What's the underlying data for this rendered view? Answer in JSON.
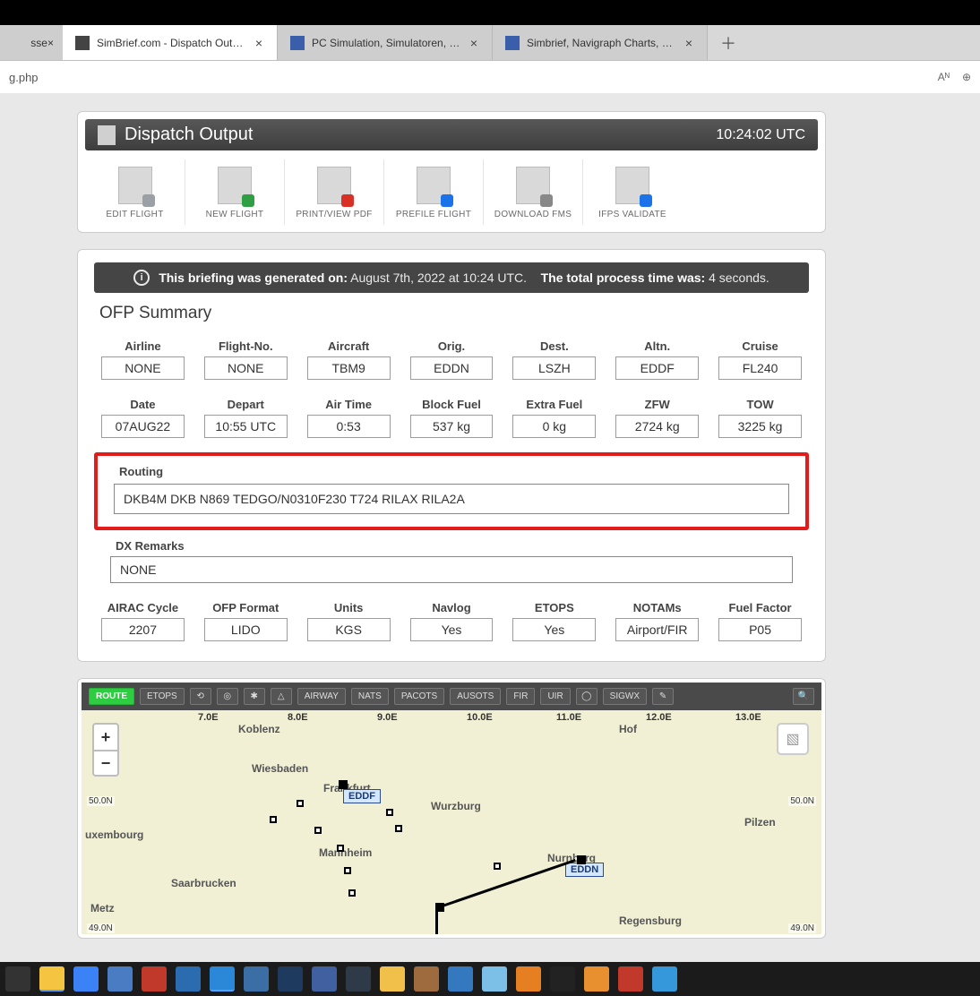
{
  "browser": {
    "tab_fragment": "sse",
    "tabs": [
      {
        "label": "SimBrief.com - Dispatch Output",
        "active": true,
        "favtype": "sb"
      },
      {
        "label": "PC Simulation, Simulatoren, Harc",
        "active": false,
        "favtype": "blue"
      },
      {
        "label": "Simbrief, Navigraph Charts, Date",
        "active": false,
        "favtype": "blue"
      }
    ],
    "address": "g.php",
    "reader_icon": "Aᴺ",
    "zoom_icon": "⊕"
  },
  "header": {
    "title": "Dispatch Output",
    "clock": "10:24:02 UTC"
  },
  "actions": [
    {
      "label": "EDIT FLIGHT",
      "badge": "#9aa0a6"
    },
    {
      "label": "NEW FLIGHT",
      "badge": "#2ea043"
    },
    {
      "label": "PRINT/VIEW PDF",
      "badge": "#d93025"
    },
    {
      "label": "PREFILE FLIGHT",
      "badge": "#1a73e8"
    },
    {
      "label": "DOWNLOAD FMS",
      "badge": "#888888"
    },
    {
      "label": "IFPS VALIDATE",
      "badge": "#1a73e8"
    }
  ],
  "info": {
    "prefix": "This briefing was generated on:",
    "date": "August 7th, 2022 at 10:24 UTC.",
    "mid": "The total process time was:",
    "time": "4 seconds."
  },
  "summary_title": "OFP Summary",
  "row1": [
    {
      "label": "Airline",
      "value": "NONE"
    },
    {
      "label": "Flight-No.",
      "value": "NONE"
    },
    {
      "label": "Aircraft",
      "value": "TBM9"
    },
    {
      "label": "Orig.",
      "value": "EDDN"
    },
    {
      "label": "Dest.",
      "value": "LSZH"
    },
    {
      "label": "Altn.",
      "value": "EDDF"
    },
    {
      "label": "Cruise",
      "value": "FL240"
    }
  ],
  "row2": [
    {
      "label": "Date",
      "value": "07AUG22"
    },
    {
      "label": "Depart",
      "value": "10:55 UTC"
    },
    {
      "label": "Air Time",
      "value": "0:53"
    },
    {
      "label": "Block Fuel",
      "value": "537 kg"
    },
    {
      "label": "Extra Fuel",
      "value": "0 kg"
    },
    {
      "label": "ZFW",
      "value": "2724 kg"
    },
    {
      "label": "TOW",
      "value": "3225 kg"
    }
  ],
  "routing": {
    "label": "Routing",
    "value": "DKB4M DKB N869 TEDGO/N0310F230 T724 RILAX RILA2A"
  },
  "remarks": {
    "label": "DX Remarks",
    "value": "NONE"
  },
  "row3": [
    {
      "label": "AIRAC Cycle",
      "value": "2207"
    },
    {
      "label": "OFP Format",
      "value": "LIDO"
    },
    {
      "label": "Units",
      "value": "KGS"
    },
    {
      "label": "Navlog",
      "value": "Yes"
    },
    {
      "label": "ETOPS",
      "value": "Yes"
    },
    {
      "label": "NOTAMs",
      "value": "Airport/FIR"
    },
    {
      "label": "Fuel Factor",
      "value": "P05"
    }
  ],
  "map_toolbar": [
    "ROUTE",
    "ETOPS",
    "⟲",
    "◎",
    "✱",
    "△",
    "AIRWAY",
    "NATS",
    "PACOTS",
    "AUSOTS",
    "FIR",
    "UIR",
    "◯",
    "SIGWX",
    "✎"
  ],
  "map": {
    "zoom_in": "+",
    "zoom_out": "−",
    "lons": [
      "7.0E",
      "8.0E",
      "9.0E",
      "10.0E",
      "11.0E",
      "12.0E",
      "13.0E"
    ],
    "lats": [
      "50.0N",
      "49.0N"
    ],
    "cities": [
      "Koblenz",
      "Hof",
      "Wiesbaden",
      "Frankfurt",
      "Wurzburg",
      "Pilzen",
      "uxembourg",
      "Mannheim",
      "Nurnberg",
      "Saarbrucken",
      "Regensburg",
      "Metz"
    ],
    "airports": [
      "EDDF",
      "EDDN"
    ],
    "search_icon": "🔍",
    "layers_icon": "▧"
  }
}
